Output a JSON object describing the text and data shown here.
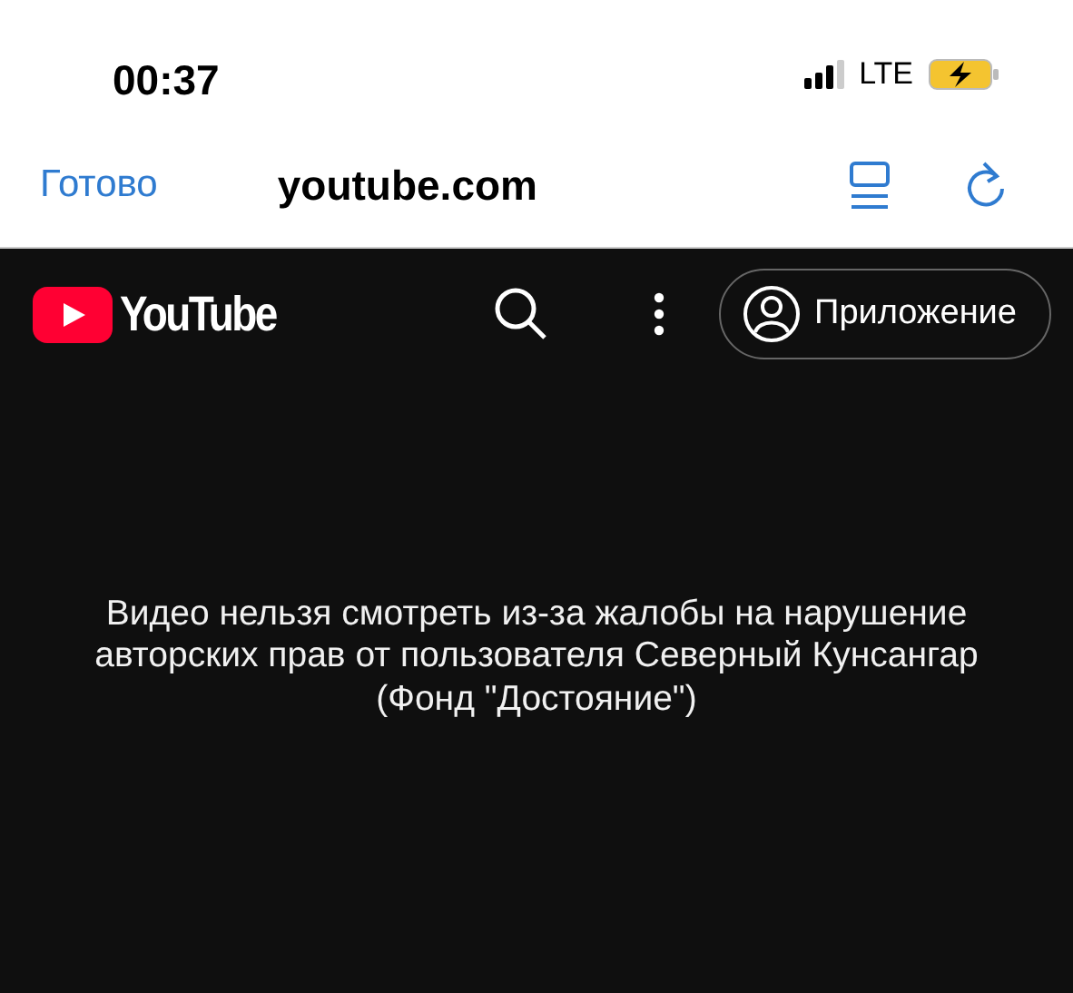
{
  "status_bar": {
    "time": "00:37",
    "network": "LTE"
  },
  "browser_bar": {
    "done": "Готово",
    "url": "youtube.com"
  },
  "header": {
    "logo": "YouTube",
    "app_button": "Приложение"
  },
  "message": "Видео нельзя смотреть из-за жалобы на нарушение авторских прав от пользователя Северный Кунсангар (Фонд \"Достояние\")"
}
